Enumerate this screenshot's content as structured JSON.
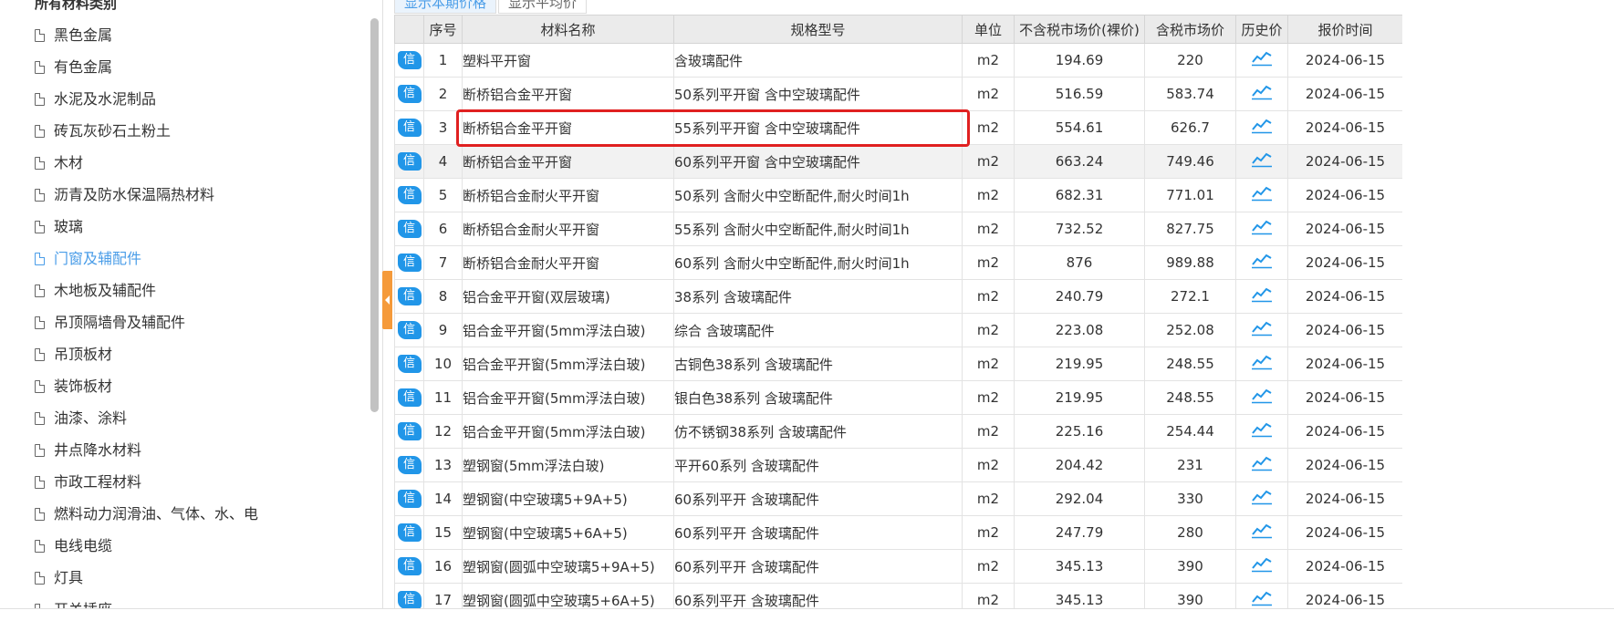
{
  "left_panel": {
    "title": "所有材料类别",
    "categories": [
      {
        "label": "黑色金属"
      },
      {
        "label": "有色金属"
      },
      {
        "label": "水泥及水泥制品"
      },
      {
        "label": "砖瓦灰砂石土粉土"
      },
      {
        "label": "木材"
      },
      {
        "label": "沥青及防水保温隔热材料"
      },
      {
        "label": "玻璃"
      },
      {
        "label": "门窗及辅配件",
        "active": true
      },
      {
        "label": "木地板及辅配件"
      },
      {
        "label": "吊顶隔墙骨及辅配件"
      },
      {
        "label": "吊顶板材"
      },
      {
        "label": "装饰板材"
      },
      {
        "label": "油漆、涂料"
      },
      {
        "label": "井点降水材料"
      },
      {
        "label": "市政工程材料"
      },
      {
        "label": "燃料动力润滑油、气体、水、电"
      },
      {
        "label": "电线电缆"
      },
      {
        "label": "灯具"
      },
      {
        "label": "开关插座"
      }
    ]
  },
  "tabs": [
    {
      "label": "显示本期价格",
      "active": true
    },
    {
      "label": "显示平均价",
      "active": false
    }
  ],
  "table": {
    "columns": [
      "",
      "序号",
      "材料名称",
      "规格型号",
      "单位",
      "不含税市场价(裸价)",
      "含税市场价",
      "历史价",
      "报价时间"
    ],
    "badge_label": "信",
    "rows": [
      {
        "no": "1",
        "name": "塑料平开窗",
        "spec": "含玻璃配件",
        "unit": "m2",
        "price_ex": "194.69",
        "price_in": "220",
        "date": "2024-06-15"
      },
      {
        "no": "2",
        "name": "断桥铝合金平开窗",
        "spec": "50系列平开窗 含中空玻璃配件",
        "unit": "m2",
        "price_ex": "516.59",
        "price_in": "583.74",
        "date": "2024-06-15"
      },
      {
        "no": "3",
        "name": "断桥铝合金平开窗",
        "spec": "55系列平开窗 含中空玻璃配件",
        "unit": "m2",
        "price_ex": "554.61",
        "price_in": "626.7",
        "date": "2024-06-15",
        "highlighted": true
      },
      {
        "no": "4",
        "name": "断桥铝合金平开窗",
        "spec": "60系列平开窗 含中空玻璃配件",
        "unit": "m2",
        "price_ex": "663.24",
        "price_in": "749.46",
        "date": "2024-06-15",
        "hover": true
      },
      {
        "no": "5",
        "name": "断桥铝合金耐火平开窗",
        "spec": "50系列 含耐火中空断配件,耐火时间1h",
        "unit": "m2",
        "price_ex": "682.31",
        "price_in": "771.01",
        "date": "2024-06-15"
      },
      {
        "no": "6",
        "name": "断桥铝合金耐火平开窗",
        "spec": "55系列 含耐火中空断配件,耐火时间1h",
        "unit": "m2",
        "price_ex": "732.52",
        "price_in": "827.75",
        "date": "2024-06-15"
      },
      {
        "no": "7",
        "name": "断桥铝合金耐火平开窗",
        "spec": "60系列 含耐火中空断配件,耐火时间1h",
        "unit": "m2",
        "price_ex": "876",
        "price_in": "989.88",
        "date": "2024-06-15"
      },
      {
        "no": "8",
        "name": "铝合金平开窗(双层玻璃)",
        "spec": "38系列 含玻璃配件",
        "unit": "m2",
        "price_ex": "240.79",
        "price_in": "272.1",
        "date": "2024-06-15"
      },
      {
        "no": "9",
        "name": "铝合金平开窗(5mm浮法白玻)",
        "spec": "综合 含玻璃配件",
        "unit": "m2",
        "price_ex": "223.08",
        "price_in": "252.08",
        "date": "2024-06-15"
      },
      {
        "no": "10",
        "name": "铝合金平开窗(5mm浮法白玻)",
        "spec": "古铜色38系列 含玻璃配件",
        "unit": "m2",
        "price_ex": "219.95",
        "price_in": "248.55",
        "date": "2024-06-15"
      },
      {
        "no": "11",
        "name": "铝合金平开窗(5mm浮法白玻)",
        "spec": "银白色38系列 含玻璃配件",
        "unit": "m2",
        "price_ex": "219.95",
        "price_in": "248.55",
        "date": "2024-06-15"
      },
      {
        "no": "12",
        "name": "铝合金平开窗(5mm浮法白玻)",
        "spec": "仿不锈钢38系列 含玻璃配件",
        "unit": "m2",
        "price_ex": "225.16",
        "price_in": "254.44",
        "date": "2024-06-15"
      },
      {
        "no": "13",
        "name": "塑钢窗(5mm浮法白玻)",
        "spec": "平开60系列 含玻璃配件",
        "unit": "m2",
        "price_ex": "204.42",
        "price_in": "231",
        "date": "2024-06-15"
      },
      {
        "no": "14",
        "name": "塑钢窗(中空玻璃5+9A+5)",
        "spec": "60系列平开 含玻璃配件",
        "unit": "m2",
        "price_ex": "292.04",
        "price_in": "330",
        "date": "2024-06-15"
      },
      {
        "no": "15",
        "name": "塑钢窗(中空玻璃5+6A+5)",
        "spec": "60系列平开 含玻璃配件",
        "unit": "m2",
        "price_ex": "247.79",
        "price_in": "280",
        "date": "2024-06-15"
      },
      {
        "no": "16",
        "name": "塑钢窗(圆弧中空玻璃5+9A+5)",
        "spec": "60系列平开 含玻璃配件",
        "unit": "m2",
        "price_ex": "345.13",
        "price_in": "390",
        "date": "2024-06-15"
      },
      {
        "no": "17",
        "name": "塑钢窗(圆弧中空玻璃5+6A+5)",
        "spec": "60系列平开 含玻璃配件",
        "unit": "m2",
        "price_ex": "345.13",
        "price_in": "390",
        "date": "2024-06-15"
      }
    ]
  },
  "colors": {
    "accent": "#4a9de8",
    "badge": "#2196e8",
    "highlight": "#e02020",
    "handle": "#f59a3a"
  }
}
